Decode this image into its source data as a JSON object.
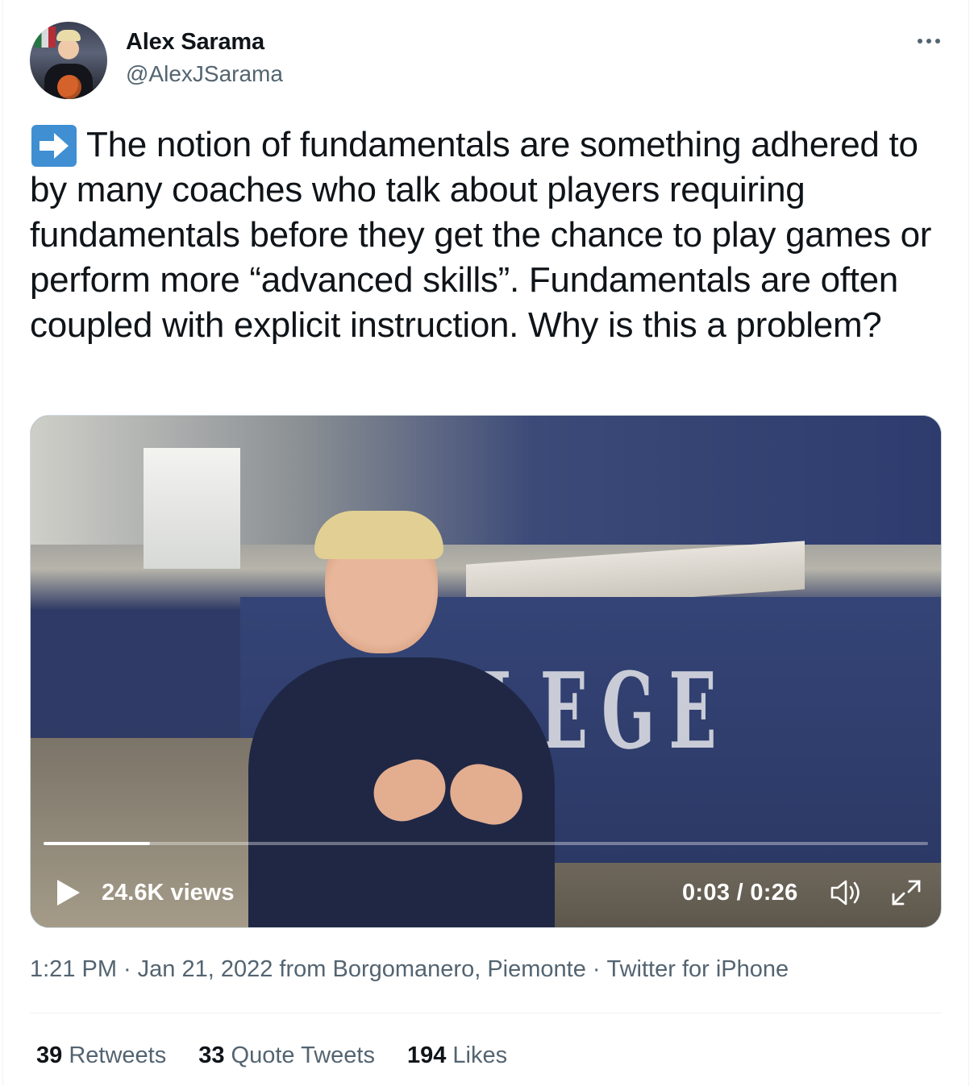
{
  "author": {
    "name": "Alex Sarama",
    "handle": "@AlexJSarama"
  },
  "tweet": {
    "emoji": "arrow-right-icon",
    "text": "The notion of fundamentals are something adhered to by many coaches who talk about players requiring fundamentals before they get the chance to play games or perform more “advanced skills”. Fundamentals are often coupled with explicit instruction. Why is this a problem?"
  },
  "video": {
    "views": "24.6K views",
    "time": "0:03 / 0:26",
    "progress_fraction": 0.12,
    "background_text": "LEGE"
  },
  "meta": {
    "time": "1:21 PM",
    "date_location": "Jan 21, 2022 from Borgomanero, Piemonte",
    "source": "Twitter for iPhone",
    "separator": "·"
  },
  "stats": {
    "retweets_count": "39",
    "retweets_label": "Retweets",
    "quotes_count": "33",
    "quotes_label": "Quote Tweets",
    "likes_count": "194",
    "likes_label": "Likes"
  },
  "colors": {
    "text_primary": "#0f1419",
    "text_secondary": "#536471",
    "emoji_blue": "#3f8fd2"
  }
}
